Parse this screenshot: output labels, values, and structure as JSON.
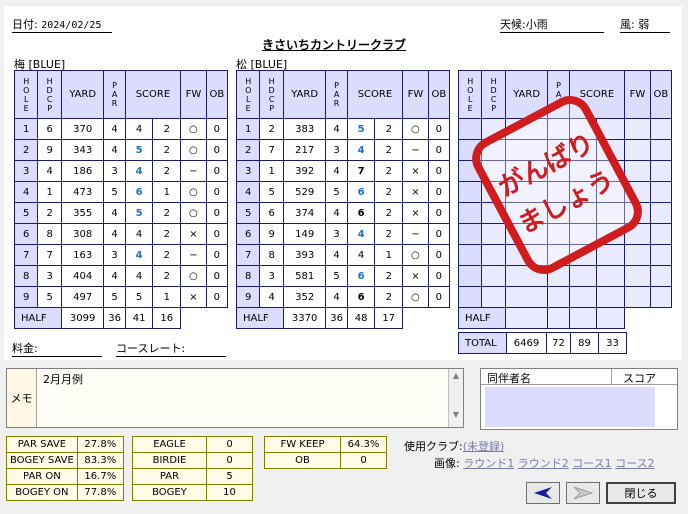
{
  "header": {
    "date_label": "日付:",
    "date": "2024/02/25",
    "weather_label": "天候:",
    "weather": "小雨",
    "wind_label": "風:",
    "wind": "弱",
    "club_name": "きさいちカントリークラブ"
  },
  "columns": {
    "hole": "HOLE",
    "hdcp": "HDCP",
    "yard": "YARD",
    "par": "PAR",
    "score": "SCORE",
    "fw": "FW",
    "ob": "OB"
  },
  "courses": [
    {
      "name": "梅 [BLUE]",
      "half_label": "HALF",
      "half_yard": "3099",
      "half_par": "36",
      "half_score": "41",
      "half_putt": "16",
      "rows": [
        {
          "hole": "1",
          "hdcp": "6",
          "yard": "370",
          "par": "4",
          "score": "4",
          "putt": "2",
          "fw": "○",
          "ob": "0",
          "style": ""
        },
        {
          "hole": "2",
          "hdcp": "9",
          "yard": "343",
          "par": "4",
          "score": "5",
          "putt": "2",
          "fw": "○",
          "ob": "0",
          "style": "blue"
        },
        {
          "hole": "3",
          "hdcp": "4",
          "yard": "186",
          "par": "3",
          "score": "4",
          "putt": "2",
          "fw": "−",
          "ob": "0",
          "style": "blue"
        },
        {
          "hole": "4",
          "hdcp": "1",
          "yard": "473",
          "par": "5",
          "score": "6",
          "putt": "1",
          "fw": "○",
          "ob": "0",
          "style": "blue"
        },
        {
          "hole": "5",
          "hdcp": "2",
          "yard": "355",
          "par": "4",
          "score": "5",
          "putt": "2",
          "fw": "○",
          "ob": "0",
          "style": "blue"
        },
        {
          "hole": "6",
          "hdcp": "8",
          "yard": "308",
          "par": "4",
          "score": "4",
          "putt": "2",
          "fw": "×",
          "ob": "0",
          "style": ""
        },
        {
          "hole": "7",
          "hdcp": "7",
          "yard": "163",
          "par": "3",
          "score": "4",
          "putt": "2",
          "fw": "−",
          "ob": "0",
          "style": "blue"
        },
        {
          "hole": "8",
          "hdcp": "3",
          "yard": "404",
          "par": "4",
          "score": "4",
          "putt": "2",
          "fw": "○",
          "ob": "0",
          "style": ""
        },
        {
          "hole": "9",
          "hdcp": "5",
          "yard": "497",
          "par": "5",
          "score": "5",
          "putt": "1",
          "fw": "×",
          "ob": "0",
          "style": ""
        }
      ]
    },
    {
      "name": "松 [BLUE]",
      "half_label": "HALF",
      "half_yard": "3370",
      "half_par": "36",
      "half_score": "48",
      "half_putt": "17",
      "rows": [
        {
          "hole": "1",
          "hdcp": "2",
          "yard": "383",
          "par": "4",
          "score": "5",
          "putt": "2",
          "fw": "○",
          "ob": "0",
          "style": "blue"
        },
        {
          "hole": "2",
          "hdcp": "7",
          "yard": "217",
          "par": "3",
          "score": "4",
          "putt": "2",
          "fw": "−",
          "ob": "0",
          "style": "blue"
        },
        {
          "hole": "3",
          "hdcp": "1",
          "yard": "392",
          "par": "4",
          "score": "7",
          "putt": "2",
          "fw": "×",
          "ob": "0",
          "style": "bold"
        },
        {
          "hole": "4",
          "hdcp": "5",
          "yard": "529",
          "par": "5",
          "score": "6",
          "putt": "2",
          "fw": "×",
          "ob": "0",
          "style": "blue"
        },
        {
          "hole": "5",
          "hdcp": "6",
          "yard": "374",
          "par": "4",
          "score": "6",
          "putt": "2",
          "fw": "×",
          "ob": "0",
          "style": "bold"
        },
        {
          "hole": "6",
          "hdcp": "9",
          "yard": "149",
          "par": "3",
          "score": "4",
          "putt": "2",
          "fw": "−",
          "ob": "0",
          "style": "blue"
        },
        {
          "hole": "7",
          "hdcp": "8",
          "yard": "393",
          "par": "4",
          "score": "4",
          "putt": "1",
          "fw": "○",
          "ob": "0",
          "style": ""
        },
        {
          "hole": "8",
          "hdcp": "3",
          "yard": "581",
          "par": "5",
          "score": "6",
          "putt": "2",
          "fw": "×",
          "ob": "0",
          "style": "blue"
        },
        {
          "hole": "9",
          "hdcp": "4",
          "yard": "352",
          "par": "4",
          "score": "6",
          "putt": "2",
          "fw": "○",
          "ob": "0",
          "style": "bold"
        }
      ]
    }
  ],
  "third": {
    "half_label": "HALF",
    "total_label": "TOTAL",
    "total_yard": "6469",
    "total_par": "72",
    "total_score": "89",
    "total_putt": "33"
  },
  "stamp": {
    "line1": "がんばり",
    "line2": "ましょう"
  },
  "fee": {
    "label": "料金:",
    "rate_label": "コースレート:"
  },
  "memo": {
    "label": "メモ",
    "text": "2月月例"
  },
  "companions": {
    "col_name": "同伴者名",
    "col_score": "スコア"
  },
  "stats": {
    "left": [
      [
        "PAR SAVE",
        "27.8%"
      ],
      [
        "BOGEY SAVE",
        "83.3%"
      ],
      [
        "PAR ON",
        "16.7%"
      ],
      [
        "BOGEY ON",
        "77.8%"
      ]
    ],
    "middle": [
      [
        "EAGLE",
        "0"
      ],
      [
        "BIRDIE",
        "0"
      ],
      [
        "PAR",
        "5"
      ],
      [
        "BOGEY",
        "10"
      ]
    ],
    "right": [
      [
        "FW KEEP",
        "64.3%"
      ],
      [
        "OB",
        "0"
      ]
    ]
  },
  "club_use": {
    "label": "使用クラブ:",
    "value": "(未登録)"
  },
  "images": {
    "label": "画像:",
    "round1": "ラウンド1",
    "round2": "ラウンド2",
    "course1": "コース1",
    "course2": "コース2"
  },
  "buttons": {
    "close": "閉じる"
  },
  "colors": {
    "stamp": "#d01c1c",
    "score_blue": "#1f6fd0",
    "grid": "#1a1a6e",
    "header_bg": "#dcdcff"
  },
  "icons": {
    "prev": "arrow-left-icon",
    "next": "arrow-right-icon"
  }
}
